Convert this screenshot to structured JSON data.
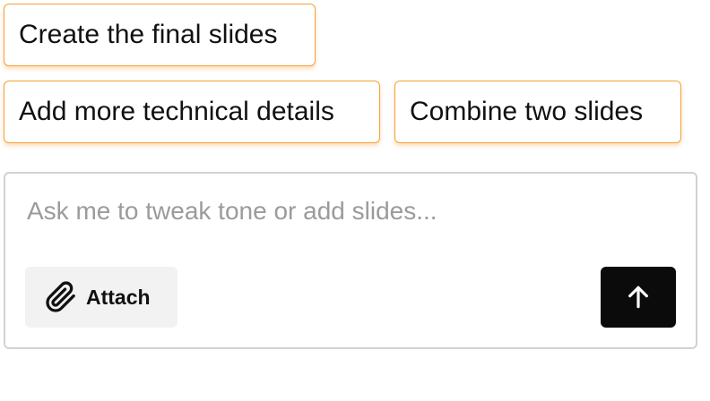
{
  "suggestions": [
    {
      "label": "Create the final slides"
    },
    {
      "label": "Add more technical details"
    },
    {
      "label": "Combine two slides"
    }
  ],
  "composer": {
    "placeholder": "Ask me to tweak tone or add slides...",
    "attach_label": "Attach",
    "attach_icon": "paperclip-icon",
    "send_icon": "arrow-up-icon"
  },
  "colors": {
    "chip_border": "#f4a13a",
    "send_button_bg": "#0b0b0b",
    "attach_button_bg": "#f2f2f2",
    "placeholder_text": "#9b9b9b"
  }
}
